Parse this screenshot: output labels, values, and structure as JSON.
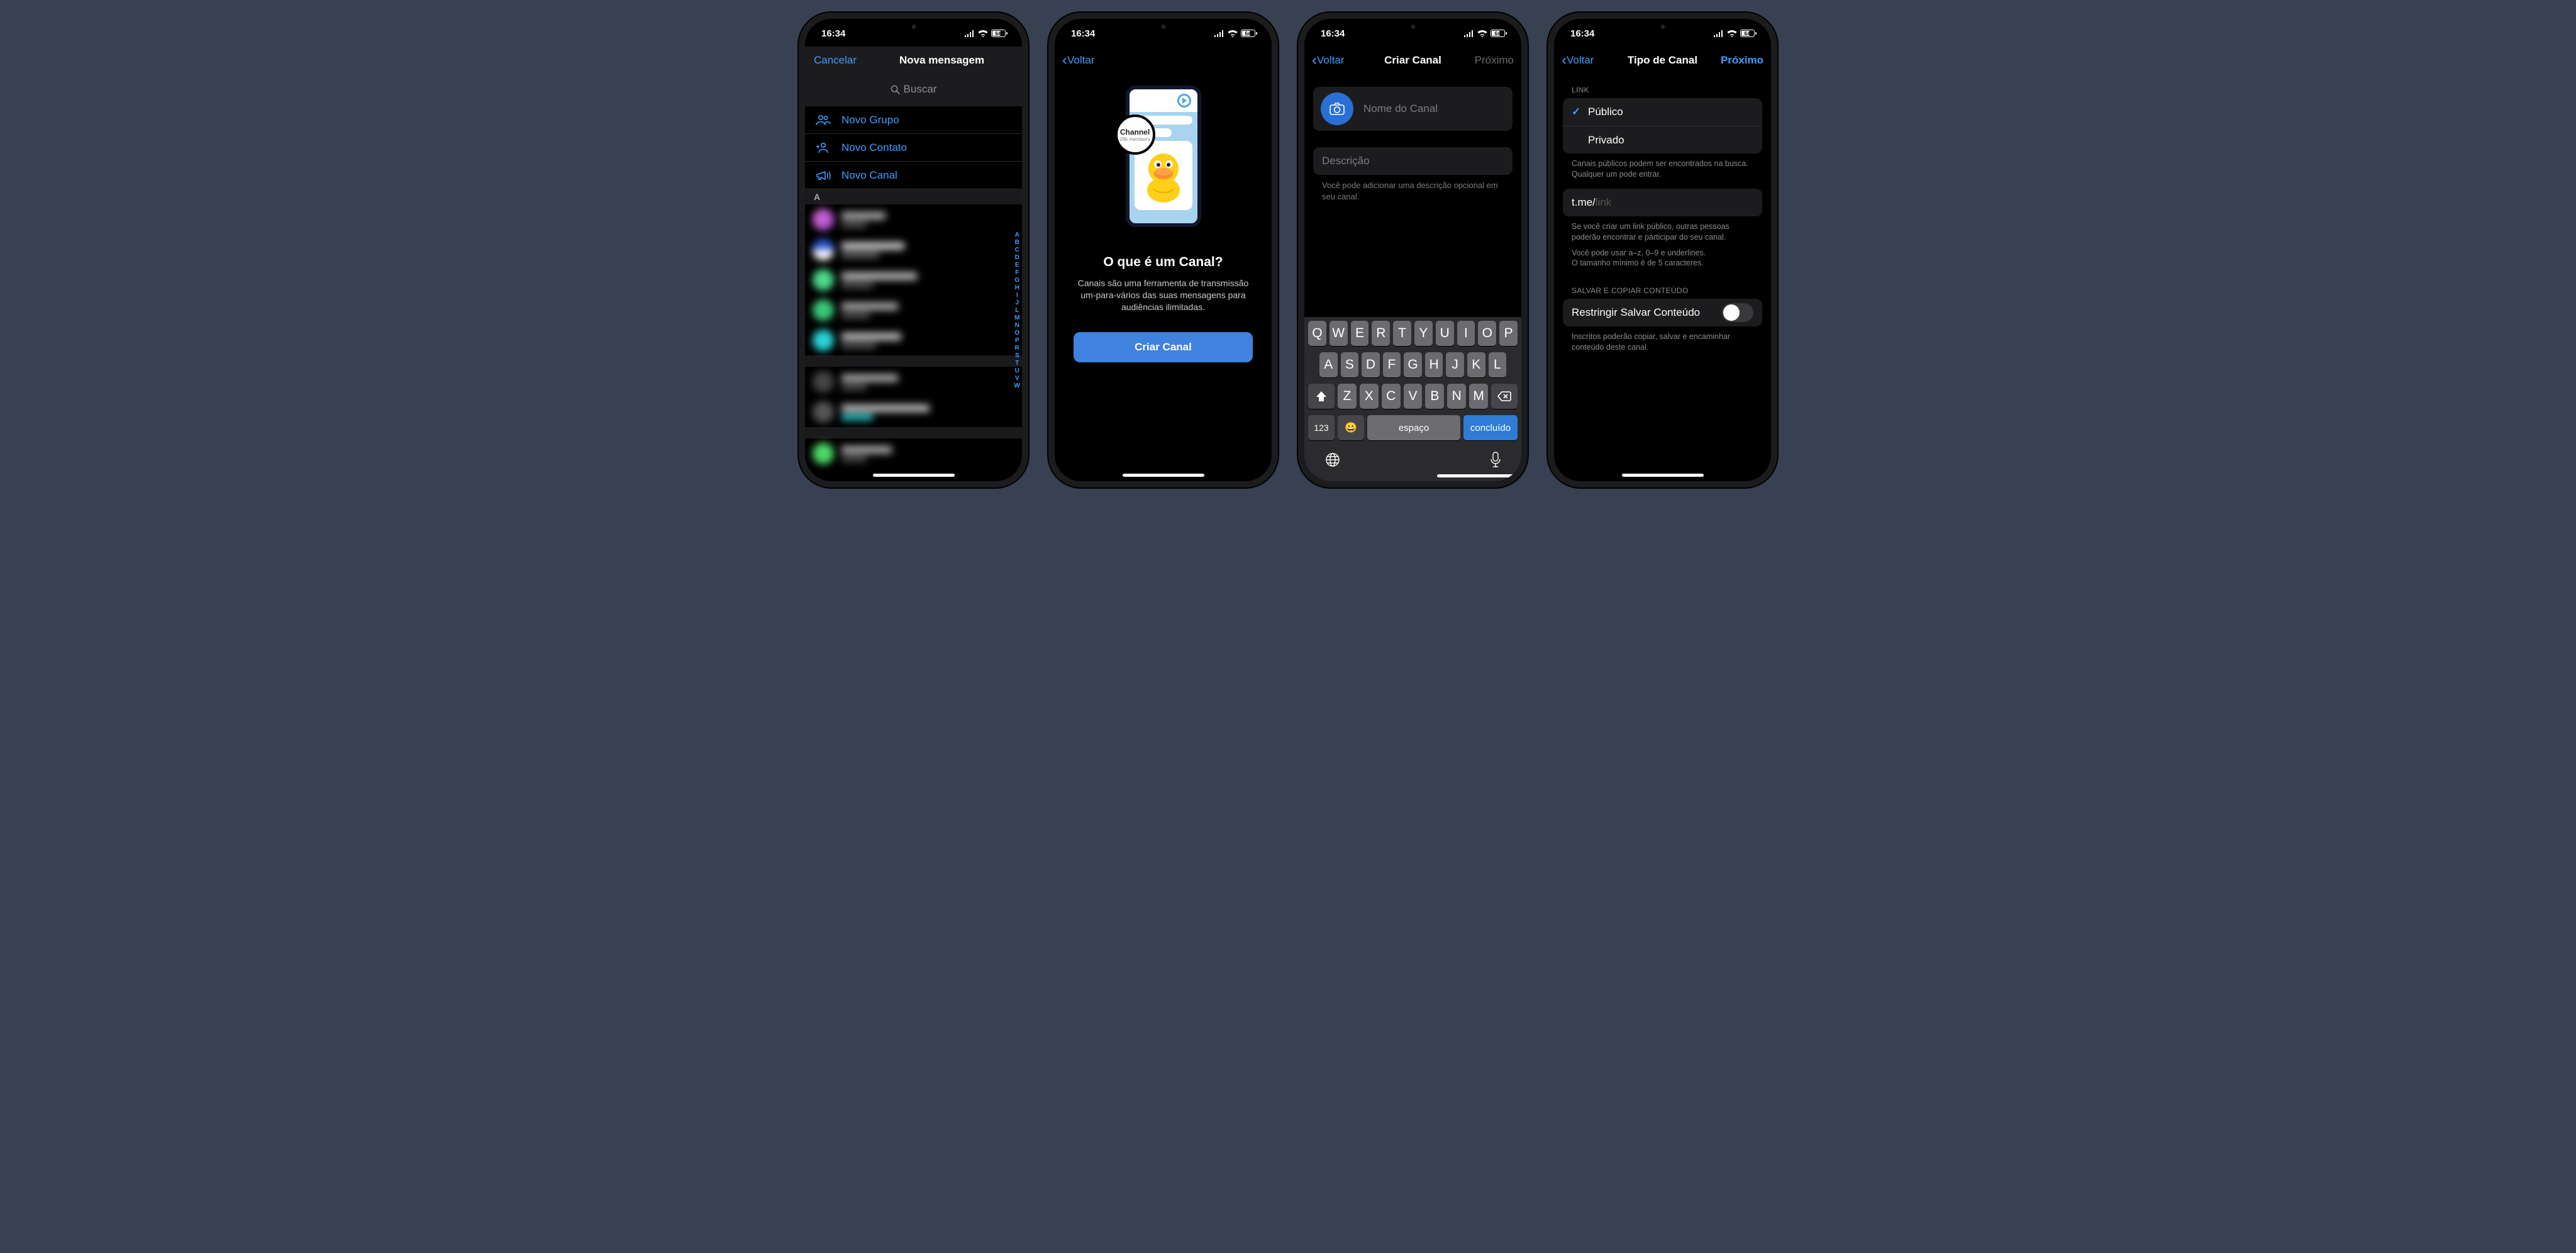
{
  "status": {
    "time": "16:34",
    "battery": "64"
  },
  "screen1": {
    "cancel": "Cancelar",
    "title": "Nova mensagem",
    "search_placeholder": "Buscar",
    "menu": {
      "new_group": "Novo Grupo",
      "new_contact": "Novo Contato",
      "new_channel": "Novo Canal"
    },
    "index_letters": [
      "A",
      "B",
      "C",
      "D",
      "E",
      "F",
      "G",
      "H",
      "I",
      "J",
      "L",
      "M",
      "N",
      "O",
      "P",
      "R",
      "S",
      "T",
      "U",
      "V",
      "W"
    ],
    "section_a": "A"
  },
  "screen2": {
    "back": "Voltar",
    "illus": {
      "channel_label": "Channel",
      "members_label": "28k members"
    },
    "title": "O que é um Canal?",
    "subtitle_l1": "Canais são uma ferramenta de transmissão",
    "subtitle_l2": "um-para-vários das suas mensagens para audiências ilimitadas.",
    "create_button": "Criar Canal"
  },
  "screen3": {
    "back": "Voltar",
    "title": "Criar Canal",
    "next": "Próximo",
    "name_placeholder": "Nome do Canal",
    "desc_placeholder": "Descrição",
    "desc_hint": "Você pode adicionar uma descrição opcional em seu canal.",
    "keyboard": {
      "row1": [
        "Q",
        "W",
        "E",
        "R",
        "T",
        "Y",
        "U",
        "I",
        "O",
        "P"
      ],
      "row2": [
        "A",
        "S",
        "D",
        "F",
        "G",
        "H",
        "J",
        "K",
        "L"
      ],
      "row3": [
        "Z",
        "X",
        "C",
        "V",
        "B",
        "N",
        "M"
      ],
      "k123": "123",
      "space": "espaço",
      "done": "concluído"
    }
  },
  "screen4": {
    "back": "Voltar",
    "title": "Tipo de Canal",
    "next": "Próximo",
    "link_header": "LINK",
    "public": "Público",
    "private": "Privado",
    "public_hint": "Canais públicos podem ser encontrados na busca. Qualquer um pode entrar.",
    "link_prefix": "t.me/",
    "link_placeholder": "link",
    "link_hint1": "Se você criar um link público, outras pessoas poderão encontrar e participar do seu canal.",
    "link_hint2": "Você pode usar a–z, 0–9 e underlines.\nO tamanho mínimo é de 5 caracteres.",
    "save_header": "SALVAR E COPIAR CONTEÚDO",
    "restrict_label": "Restringir Salvar Conteúdo",
    "restrict_hint": "Inscritos poderão copiar, salvar e encaminhar conteúdo deste canal."
  }
}
